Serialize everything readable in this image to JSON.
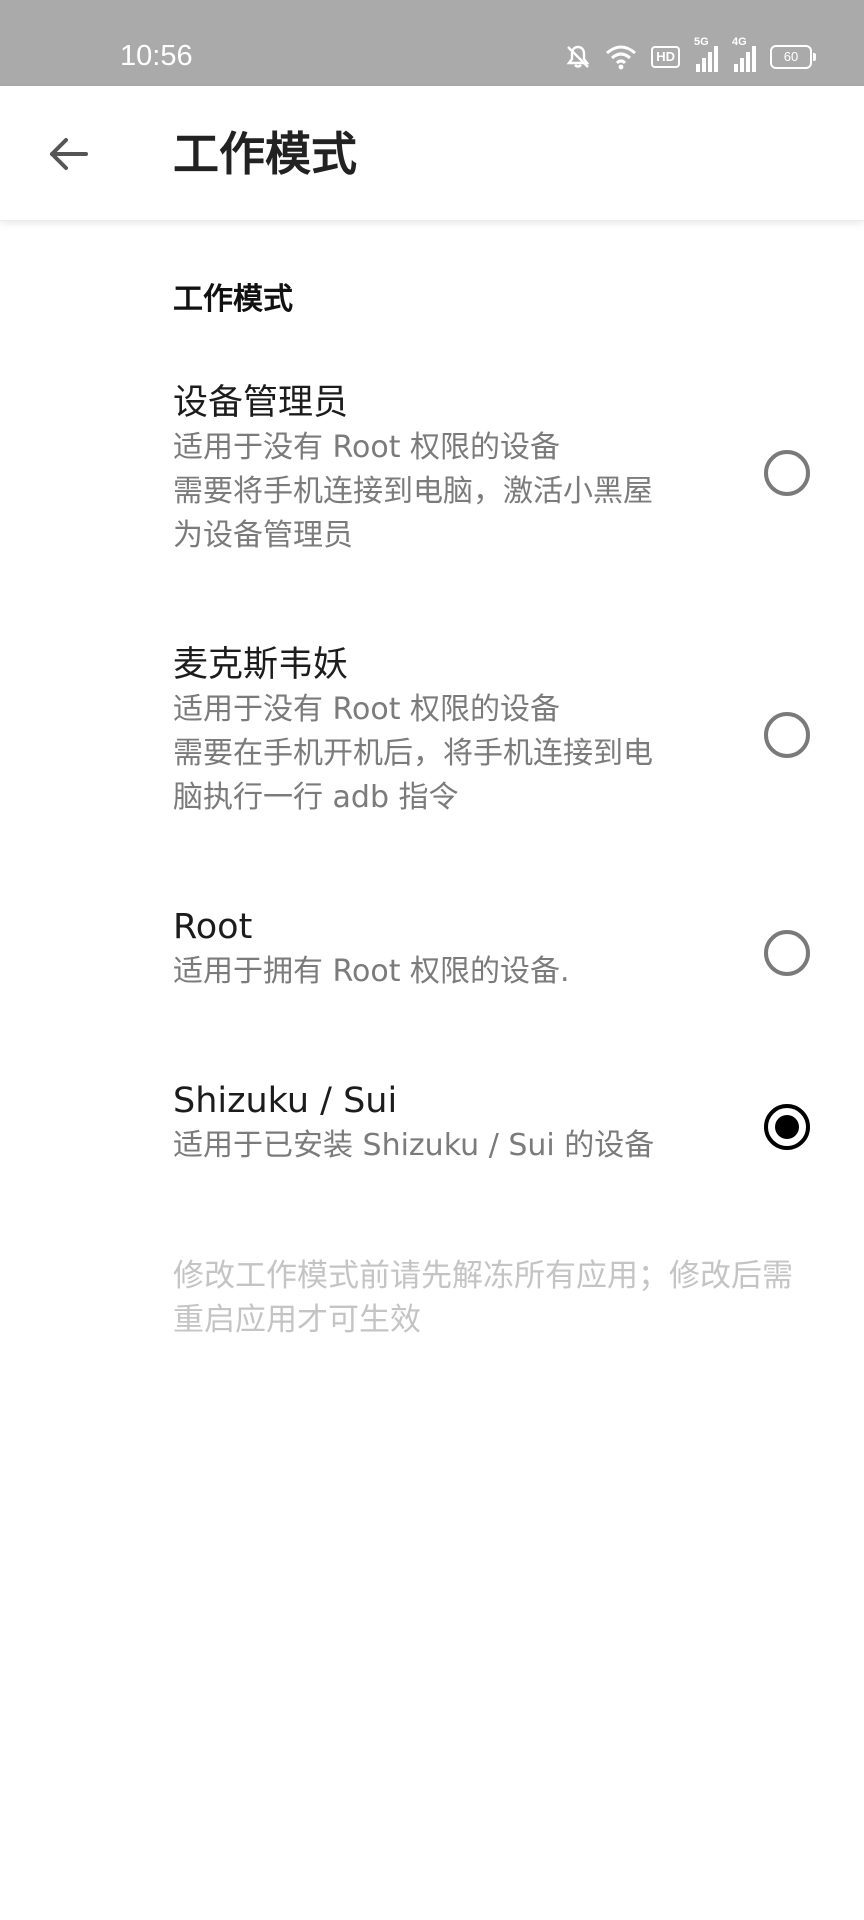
{
  "status_bar": {
    "time": "10:56",
    "hd_label": "HD",
    "network_5g": "5G",
    "network_4g": "4G",
    "battery": "60"
  },
  "app_bar": {
    "title": "工作模式"
  },
  "section": {
    "header": "工作模式"
  },
  "options": [
    {
      "title": "设备管理员",
      "desc": "适用于没有 Root 权限的设备\n需要将手机连接到电脑，激活小黑屋\n为设备管理员",
      "selected": false
    },
    {
      "title": "麦克斯韦妖",
      "desc": "适用于没有 Root 权限的设备\n需要在手机开机后，将手机连接到电\n脑执行一行 adb 指令",
      "selected": false
    },
    {
      "title": "Root",
      "desc": "适用于拥有 Root 权限的设备.",
      "selected": false
    },
    {
      "title": "Shizuku / Sui",
      "desc": "适用于已安装 Shizuku / Sui 的设备",
      "selected": true
    }
  ],
  "footnote": "修改工作模式前请先解冻所有应用；修改后需重启应用才可生效"
}
